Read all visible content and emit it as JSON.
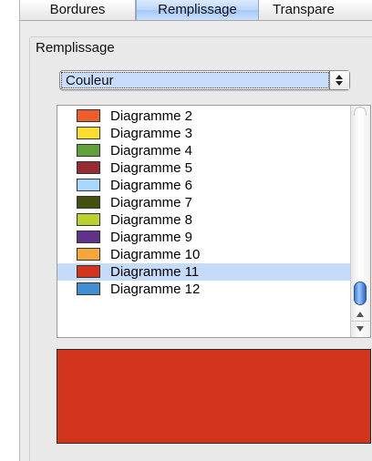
{
  "tabs": [
    {
      "label": "Bordures"
    },
    {
      "label": "Remplissage"
    },
    {
      "label": "Transpare"
    }
  ],
  "group": {
    "label": "Remplissage"
  },
  "fill_type": {
    "selected": "Couleur"
  },
  "color_list": {
    "items": [
      {
        "label": "Diagramme 2",
        "color": "#ee5e2c"
      },
      {
        "label": "Diagramme 3",
        "color": "#f8dd32"
      },
      {
        "label": "Diagramme 4",
        "color": "#62a13a"
      },
      {
        "label": "Diagramme 5",
        "color": "#962b34"
      },
      {
        "label": "Diagramme 6",
        "color": "#a8d9fc"
      },
      {
        "label": "Diagramme 7",
        "color": "#43500f"
      },
      {
        "label": "Diagramme 8",
        "color": "#b9d22e"
      },
      {
        "label": "Diagramme 9",
        "color": "#62318a"
      },
      {
        "label": "Diagramme 10",
        "color": "#f6a73a"
      },
      {
        "label": "Diagramme 11",
        "color": "#d2351b"
      },
      {
        "label": "Diagramme 12",
        "color": "#3f8fd6"
      }
    ],
    "selected": "Diagramme 11"
  },
  "preview": {
    "color": "#d2351b"
  },
  "colors": {
    "accent": "#c5dbfa",
    "panel": "#ececec"
  }
}
